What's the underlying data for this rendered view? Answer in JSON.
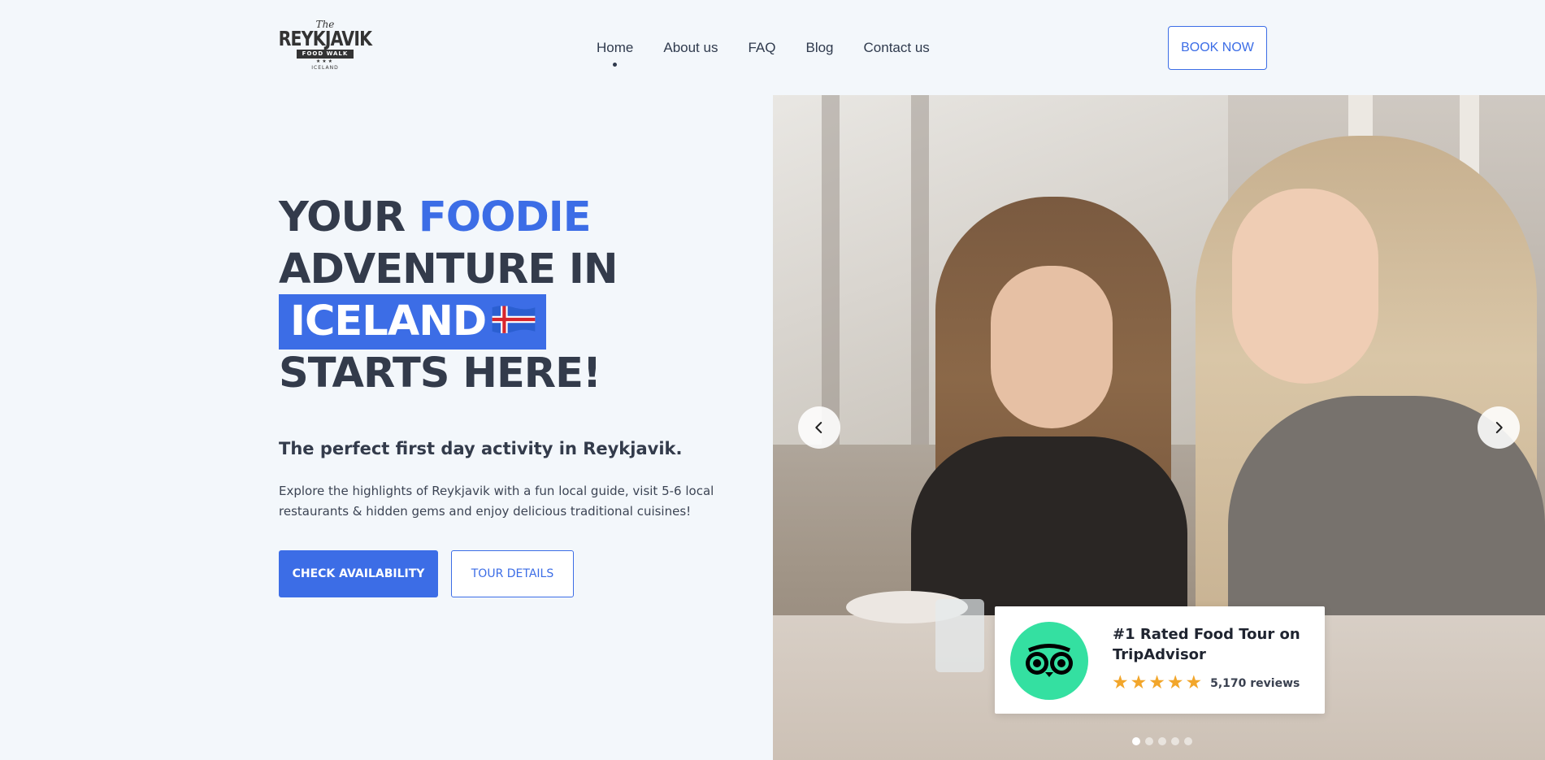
{
  "logo": {
    "the": "The",
    "main": "REYKJAVIK",
    "ribbon": "FOOD WALK",
    "stars": "★★★",
    "sub": "ICELAND"
  },
  "nav": {
    "items": [
      {
        "label": "Home",
        "active": true
      },
      {
        "label": "About us"
      },
      {
        "label": "FAQ"
      },
      {
        "label": "Blog"
      },
      {
        "label": "Contact us"
      }
    ],
    "book_now": "BOOK NOW"
  },
  "hero": {
    "line1_a": "YOUR",
    "line1_b": "FOODIE",
    "line2": "ADVENTURE IN",
    "line3": "ICELAND",
    "line3_icon": "iceland-flag-icon",
    "line4": "STARTS HERE!",
    "subtitle": "The perfect first day activity in Reykjavik.",
    "description": "Explore the highlights of Reykjavik with a fun local guide, visit 5-6 local restaurants & hidden gems and enjoy delicious traditional cuisines!",
    "cta_primary": "CHECK AVAILABILITY",
    "cta_secondary": "TOUR DETAILS"
  },
  "carousel": {
    "prev_icon": "chevron-left-icon",
    "next_icon": "chevron-right-icon",
    "slide_count": 5,
    "active_slide": 1
  },
  "badge": {
    "icon": "tripadvisor-owl-icon",
    "title": "#1 Rated Food Tour on TripAdvisor",
    "rating": 5,
    "reviews": "5,170 reviews"
  },
  "colors": {
    "accent": "#3c6de6",
    "text": "#333b4b",
    "background": "#f3f7fb",
    "tripadvisor": "#34e0a1",
    "star": "#f2a62b"
  }
}
